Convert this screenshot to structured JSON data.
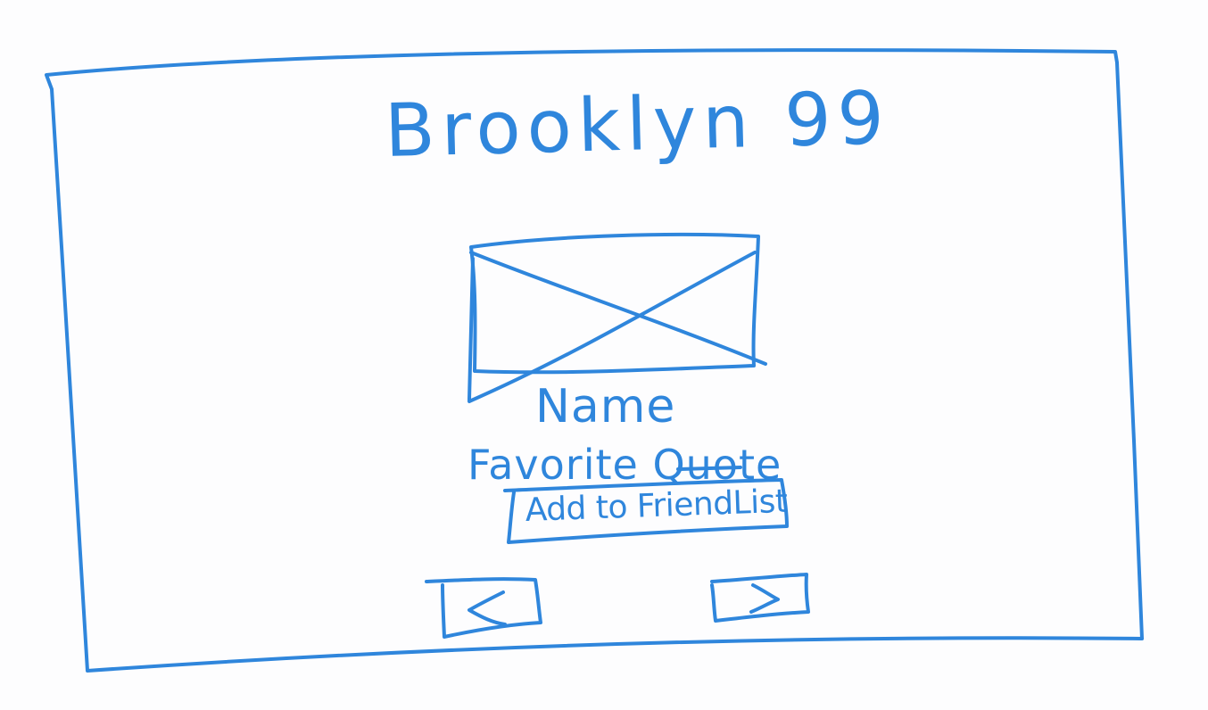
{
  "page": {
    "title": "Brooklyn 99"
  },
  "profile": {
    "image_placeholder": "image-placeholder",
    "name": "Name",
    "favorite_quote": "Favorite Quote"
  },
  "actions": {
    "add_friend_label": "Add to FriendList",
    "prev_label": "<",
    "next_label": ">"
  },
  "colors": {
    "ink": "#2f86dc",
    "background": "#fdfdfe"
  }
}
